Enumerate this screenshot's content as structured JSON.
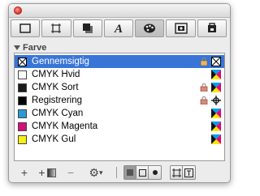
{
  "window": {
    "title": ""
  },
  "panel_tabs": [
    {
      "name": "tab-frame",
      "icon": "rectangle-icon"
    },
    {
      "name": "tab-box",
      "icon": "box-icon"
    },
    {
      "name": "tab-shadow",
      "icon": "shadow-icon"
    },
    {
      "name": "tab-character",
      "icon": "italic-a-icon"
    },
    {
      "name": "tab-colors",
      "icon": "palette-icon"
    },
    {
      "name": "tab-image",
      "icon": "image-frame-icon"
    },
    {
      "name": "tab-lock",
      "icon": "lock-icon"
    }
  ],
  "section": {
    "title": "Farve"
  },
  "colors": [
    {
      "label": "Gennemsigtig",
      "swatch": "none",
      "locked": true,
      "model": "none",
      "selected": true
    },
    {
      "label": "CMYK Hvid",
      "swatch": "#ffffff",
      "locked": false,
      "model": "cmyk",
      "selected": false
    },
    {
      "label": "CMYK Sort",
      "swatch": "#1a1a1a",
      "locked": true,
      "model": "cmyk",
      "selected": false
    },
    {
      "label": "Registrering",
      "swatch": "#000000",
      "locked": true,
      "model": "registration",
      "selected": false
    },
    {
      "label": "CMYK Cyan",
      "swatch": "#2b9ad6",
      "locked": false,
      "model": "cmyk",
      "selected": false
    },
    {
      "label": "CMYK Magenta",
      "swatch": "#d3117c",
      "locked": false,
      "model": "cmyk",
      "selected": false
    },
    {
      "label": "CMYK Gul",
      "swatch": "#f7ee12",
      "locked": false,
      "model": "cmyk",
      "selected": false
    }
  ],
  "bottom": {
    "add": "+",
    "add_gradient": "+",
    "remove": "−",
    "gear": "⚙",
    "gear_arrow": "▾"
  },
  "accent": "#3875d7"
}
